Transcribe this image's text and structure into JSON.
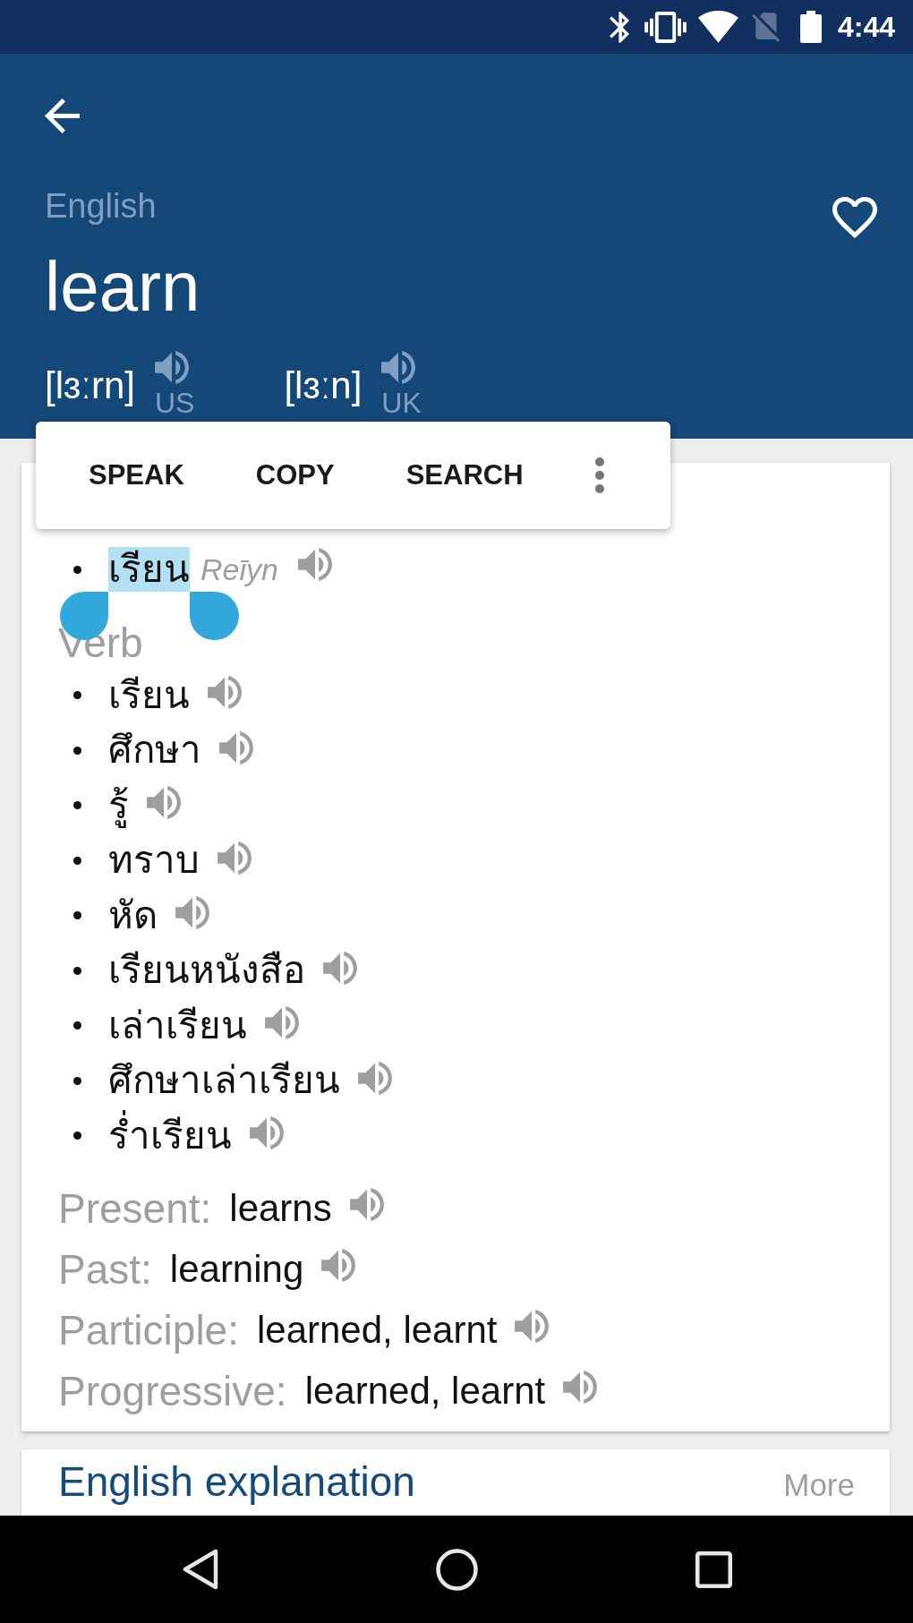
{
  "status_bar": {
    "time": "4:44"
  },
  "header": {
    "language": "English",
    "word": "learn",
    "favorite": false,
    "pronunciations": [
      {
        "ipa": "[lɜːrn]",
        "region": "US"
      },
      {
        "ipa": "[lɜːn]",
        "region": "UK"
      }
    ]
  },
  "selection_toolbar": {
    "actions": [
      "SPEAK",
      "COPY",
      "SEARCH"
    ]
  },
  "definition": {
    "items": [
      {
        "text": "เรียน",
        "romanization": "Reīyn",
        "selected": true
      }
    ]
  },
  "verb": {
    "heading": "Verb",
    "items": [
      "เรียน",
      "ศึกษา",
      "รู้",
      "ทราบ",
      "หัด",
      "เรียนหนังสือ",
      "เล่าเรียน",
      "ศึกษาเล่าเรียน",
      "ร่ำเรียน"
    ]
  },
  "forms": [
    {
      "label": "Present:",
      "value": "learns"
    },
    {
      "label": "Past:",
      "value": "learning"
    },
    {
      "label": "Participle:",
      "value": "learned, learnt"
    },
    {
      "label": "Progressive:",
      "value": "learned, learnt"
    }
  ],
  "explanation_card": {
    "title": "English explanation",
    "more": "More"
  }
}
